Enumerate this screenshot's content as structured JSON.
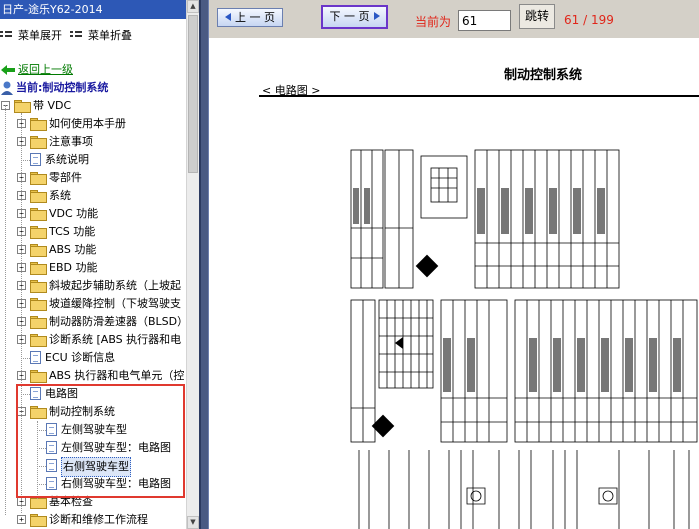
{
  "left_pane": {
    "title": "日产-途乐Y62-2014",
    "menu": {
      "expand_label": "菜单展开",
      "collapse_label": "菜单折叠"
    },
    "back_link": "返回上一级",
    "current": "当前:制动控制系统",
    "tree": [
      {
        "label": "带 VDC",
        "type": "folder-open",
        "expander": "−"
      },
      {
        "label": "如何使用本手册",
        "type": "folder",
        "expander": "+"
      },
      {
        "label": "注意事项",
        "type": "folder",
        "expander": "+"
      },
      {
        "label": "系统说明",
        "type": "doc"
      },
      {
        "label": "零部件",
        "type": "folder",
        "expander": "+"
      },
      {
        "label": "系统",
        "type": "folder",
        "expander": "+"
      },
      {
        "label": "VDC 功能",
        "type": "folder",
        "expander": "+"
      },
      {
        "label": "TCS 功能",
        "type": "folder",
        "expander": "+"
      },
      {
        "label": "ABS 功能",
        "type": "folder",
        "expander": "+"
      },
      {
        "label": "EBD 功能",
        "type": "folder",
        "expander": "+"
      },
      {
        "label": "斜坡起步辅助系统（上坡起",
        "type": "folder",
        "expander": "+"
      },
      {
        "label": "坡道缓降控制（下坡驾驶支",
        "type": "folder",
        "expander": "+"
      },
      {
        "label": "制动器防滑差速器（BLSD）",
        "type": "folder",
        "expander": "+"
      },
      {
        "label": "诊断系统 [ABS 执行器和电",
        "type": "folder",
        "expander": "+"
      },
      {
        "label": "ECU 诊断信息",
        "type": "doc"
      },
      {
        "label": "ABS 执行器和电气单元（控",
        "type": "folder",
        "expander": "+"
      },
      {
        "label": "电路图",
        "type": "doc"
      },
      {
        "label": "制动控制系统",
        "type": "folder-open",
        "expander": "−"
      },
      {
        "label": "左侧驾驶车型",
        "type": "doc"
      },
      {
        "label": "左侧驾驶车型：电路图",
        "type": "doc"
      },
      {
        "label": "右侧驾驶车型",
        "type": "doc",
        "selected": true
      },
      {
        "label": "右侧驾驶车型：电路图",
        "type": "doc"
      },
      {
        "label": "基本检查",
        "type": "folder",
        "expander": "+"
      },
      {
        "label": "诊断和维修工作流程",
        "type": "folder",
        "expander": "+"
      }
    ]
  },
  "toolbar": {
    "prev_label": "上 一 页",
    "next_label": "下 一 页",
    "current_label": "当前为",
    "page_value": "61",
    "jump_label": "跳转",
    "page_count": "61 / 199"
  },
  "document": {
    "title": "制动控制系统",
    "section": "< 电路图 >"
  },
  "colors": {
    "title_bar": "#2d58b6",
    "divider": "#4a5a83",
    "toolbar_bg": "#d4d0c8",
    "highlight_box": "#e0392f",
    "accent_red": "#e0261a"
  }
}
